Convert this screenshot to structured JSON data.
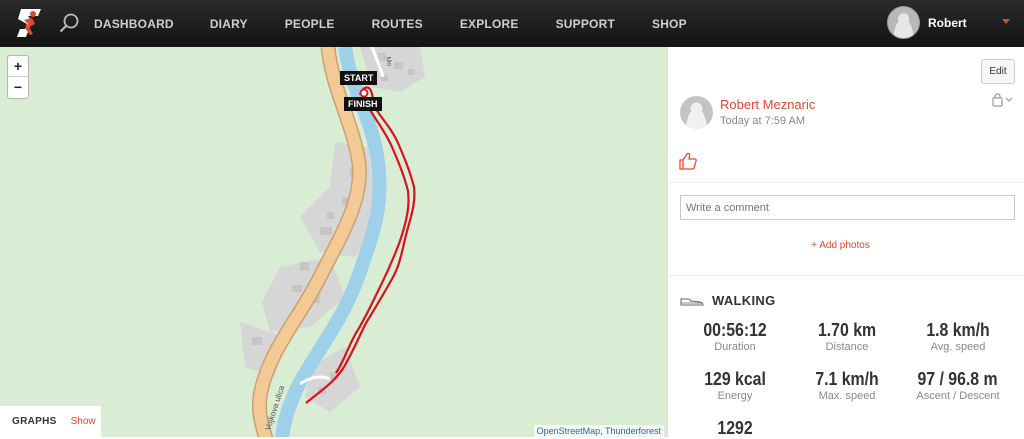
{
  "nav": {
    "items": [
      "DASHBOARD",
      "DIARY",
      "PEOPLE",
      "ROUTES",
      "EXPLORE",
      "SUPPORT",
      "SHOP"
    ],
    "user_name": "Robert"
  },
  "map": {
    "zoom_in": "+",
    "zoom_out": "−",
    "start_label": "START",
    "finish_label": "FINISH",
    "street_label": "Vojkova ulica",
    "street_label_2": "Mo",
    "attribution_a": "OpenStreetMap",
    "attribution_sep": ", ",
    "attribution_b": "Thunderforest",
    "graphs_title": "GRAPHS",
    "graphs_toggle": "Show"
  },
  "panel": {
    "edit_label": "Edit",
    "author": "Robert Meznaric",
    "timestamp": "Today at 7:59 AM",
    "comment_placeholder": "Write a comment",
    "add_photos": "+ Add photos",
    "activity_type": "WALKING",
    "stats": [
      {
        "value": "00:56:12",
        "label": "Duration"
      },
      {
        "value": "1.70 km",
        "label": "Distance"
      },
      {
        "value": "1.8 km/h",
        "label": "Avg. speed"
      },
      {
        "value": "129 kcal",
        "label": "Energy"
      },
      {
        "value": "7.1 km/h",
        "label": "Max. speed"
      },
      {
        "value": "97 / 96.8 m",
        "label": "Ascent / Descent"
      },
      {
        "value": "1292",
        "label": ""
      }
    ]
  },
  "colors": {
    "accent": "#e2492f",
    "route": "#d8141a",
    "river": "#a8d4ec",
    "road": "#f0c48a",
    "map_green": "#d9ecd4"
  }
}
